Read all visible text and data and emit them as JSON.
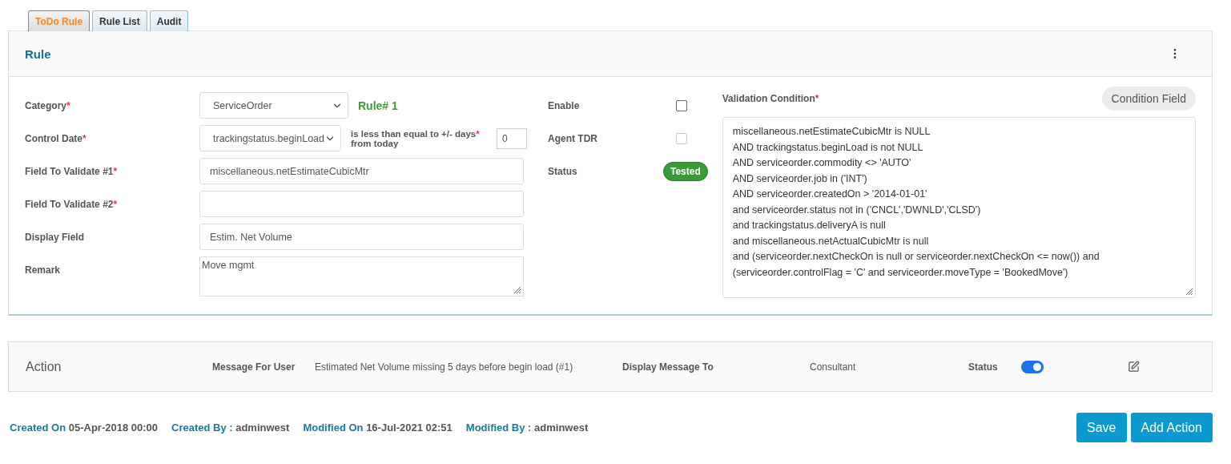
{
  "tabs": [
    {
      "label": "ToDo Rule",
      "selected": true
    },
    {
      "label": "Rule List",
      "selected": false
    },
    {
      "label": "Audit",
      "selected": false
    }
  ],
  "rule_panel": {
    "title": "Rule",
    "fields": [
      {
        "label": "Category",
        "mark": "*",
        "kind": "select",
        "value": "ServiceOrder"
      },
      {
        "label": "Control Date",
        "mark": "*",
        "kind": "select",
        "value": "trackingstatus.beginLoad"
      },
      {
        "label": "Field To Validate #1",
        "mark": "*",
        "kind": "input",
        "value": "miscellaneous.netEstimateCubicMtr"
      },
      {
        "label": "Field To Validate #2",
        "mark": "*",
        "kind": "input"
      },
      {
        "label": "Display Field",
        "kind": "input",
        "value": "Estim. Net Volume"
      },
      {
        "label": "Remark",
        "kind": "textarea",
        "value": "Move mgmt"
      }
    ],
    "rule_number": "Rule# 1",
    "days_field": {
      "label": "is less than equal to +/- days",
      "mark": "*",
      "suffix": "from today",
      "value": "0"
    },
    "flags": [
      {
        "label": "Enable",
        "kind": "checkbox",
        "checked": false,
        "disabled": false
      },
      {
        "label": "Agent TDR",
        "kind": "checkbox",
        "checked": false,
        "disabled": true
      },
      {
        "label": "Status",
        "kind": "badge",
        "value": "Tested"
      }
    ],
    "validation": {
      "label": "Validation Condition",
      "mark": "*",
      "button": "Condition Field",
      "lines": [
        "miscellaneous.netEstimateCubicMtr is NULL",
        "AND trackingstatus.beginLoad is not NULL",
        "AND serviceorder.commodity <> 'AUTO'",
        "AND serviceorder.job in ('INT')",
        "AND serviceorder.createdOn > '2014-01-01'",
        "and serviceorder.status not in ('CNCL','DWNLD','CLSD')",
        "and trackingstatus.deliveryA is null",
        "and miscellaneous.netActualCubicMtr is null",
        "and (serviceorder.nextCheckOn is null or serviceorder.nextCheckOn <= now()) and",
        "(serviceorder.controlFlag = 'C' and serviceorder.moveType = 'BookedMove')"
      ]
    }
  },
  "action": {
    "title": "Action",
    "message_label": "Message For User",
    "message": "Estimated Net Volume missing 5 days before begin load (#1)",
    "display_label": "Display Message To",
    "display_to": "Consultant",
    "status_label": "Status",
    "status_on": true
  },
  "footer": {
    "meta": [
      {
        "label": "Created On",
        "value": "05-Apr-2018 00:00"
      },
      {
        "label": "Created By :",
        "value": "adminwest"
      },
      {
        "label": "Modified On",
        "value": "16-Jul-2021 02:51"
      },
      {
        "label": "Modified By :",
        "value": "adminwest"
      }
    ],
    "buttons": [
      "Save",
      "Add Action"
    ]
  }
}
